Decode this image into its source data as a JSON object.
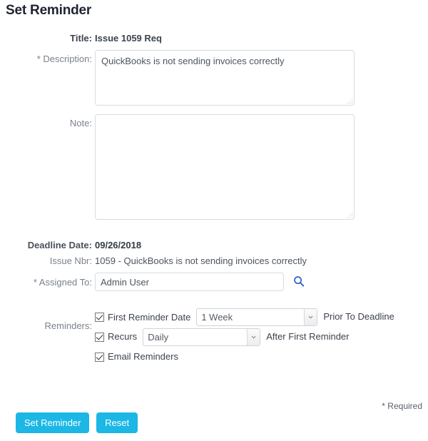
{
  "page": {
    "title": "Set Reminder"
  },
  "form": {
    "title_label": "Title:",
    "title_value": "Issue 1059 Req",
    "description_label": "* Description:",
    "description_value": "QuickBooks is not sending invoices correctly",
    "description_placeholder": "",
    "note_label": "Note:",
    "note_value": "",
    "note_placeholder": "",
    "deadline_label": "Deadline Date:",
    "deadline_value": "09/26/2018",
    "issue_label": "Issue Nbr:",
    "issue_value": "1059 - QuickBooks is not sending invoices correctly",
    "assigned_label": "* Assigned To:",
    "assigned_value": "Admin User",
    "assigned_placeholder": "",
    "search_icon": "search-icon"
  },
  "reminders": {
    "label": "Reminders:",
    "first_reminder_checkbox_label": "First Reminder Date",
    "first_reminder_checked": true,
    "first_reminder_selected": "1 Week",
    "first_reminder_options": [
      "1 Week"
    ],
    "first_reminder_suffix": "Prior To Deadline",
    "recurs_checkbox_label": "Recurs",
    "recurs_checked": true,
    "recurs_selected": "Daily",
    "recurs_options": [
      "Daily"
    ],
    "recurs_suffix": "After First Reminder",
    "email_checkbox_label": "Email Reminders",
    "email_checked": true
  },
  "footer": {
    "required_note": "* Required",
    "submit_label": "Set Reminder",
    "reset_label": "Reset",
    "button_color": "#1cb7e5"
  }
}
